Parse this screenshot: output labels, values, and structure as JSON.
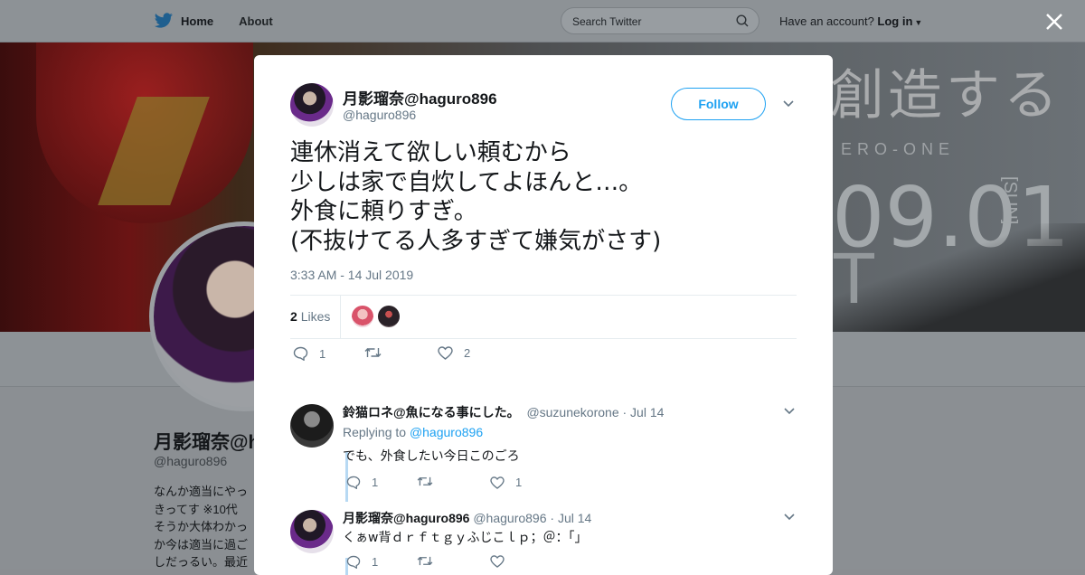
{
  "nav": {
    "home_label": "Home",
    "about_label": "About",
    "search_placeholder": "Search Twitter",
    "have_account": "Have an account?",
    "login_label": "Log in"
  },
  "banner": {
    "text_jp": "創造する",
    "text_sub": "ERO-ONE",
    "date": "09.01",
    "day": "[SUN]",
    "text_t": "T"
  },
  "profile": {
    "name": "月影瑠奈@h",
    "handle": "@haguro896",
    "bio_lines": [
      "なんか適当にやっ",
      "きってす ※10代",
      "そうか大体わかっ",
      "か今は適当に過ご",
      "しだっるい。最近"
    ]
  },
  "tweet": {
    "author_name": "月影瑠奈@haguro896",
    "author_handle": "@haguro896",
    "follow_label": "Follow",
    "text_lines": [
      "連休消えて欲しい頼むから",
      "少しは家で自炊してよほんと…。",
      "外食に頼りすぎ。",
      "(不抜けてる人多すぎて嫌気がさす)"
    ],
    "timestamp": "3:33 AM - 14 Jul 2019",
    "likes_count": "2",
    "likes_label": "Likes",
    "reply_count": "1",
    "like_count": "2",
    "colors": {
      "accent": "#1da1f2",
      "text": "#14171a",
      "muted": "#657786"
    }
  },
  "replies": [
    {
      "name": "鈴猫ロネ@魚になる事にした。",
      "handle": "@suzunekorone",
      "date": "· Jul 14",
      "replying_prefix": "Replying to",
      "replying_to": "@haguro896",
      "text": "でも、外食したい今日このごろ",
      "reply_count": "1",
      "like_count": "1"
    },
    {
      "name": "月影瑠奈@haguro896",
      "handle": "@haguro896",
      "date": "· Jul 14",
      "text": "くぁw背ｄｒｆｔｇｙふじこｌｐ；＠：「」",
      "reply_count": "1",
      "like_count": ""
    }
  ]
}
